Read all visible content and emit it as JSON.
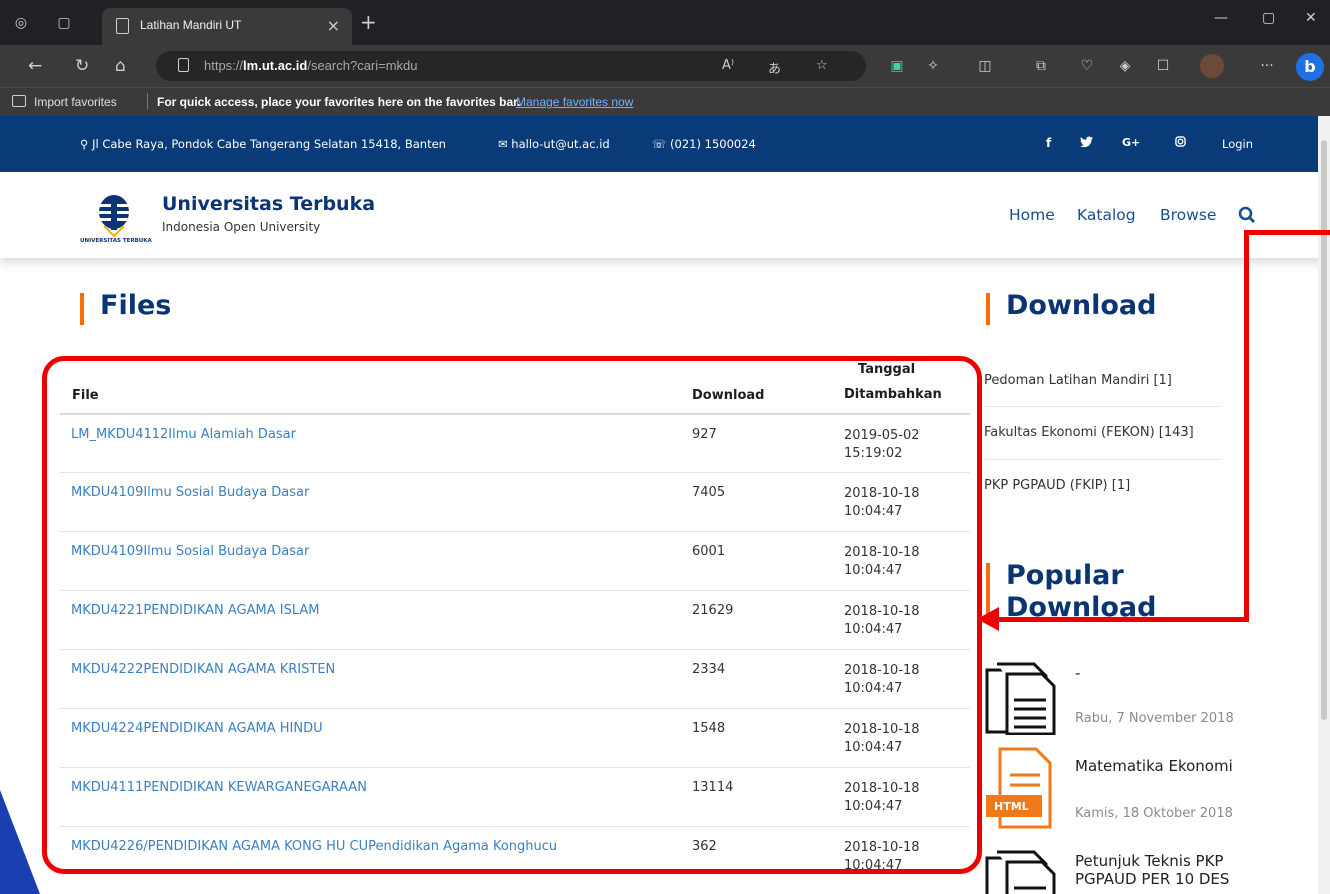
{
  "browser": {
    "tab_title": "Latihan Mandiri UT",
    "url_prefix": "https://",
    "url_domain": "lm.ut.ac.id",
    "url_path": "/search?cari=mkdu",
    "favbar_import": "Import favorites",
    "favbar_message": "For quick access, place your favorites here on the favorites bar.",
    "favbar_manage": "Manage favorites now"
  },
  "topbar": {
    "address": "Jl Cabe Raya, Pondok Cabe Tangerang Selatan 15418, Banten",
    "email": "hallo-ut@ut.ac.id",
    "phone": "(021) 1500024",
    "social": [
      "f",
      "G+"
    ],
    "login": "Login"
  },
  "header": {
    "brand": "Universitas Terbuka",
    "tagline": "Indonesia Open University",
    "logo_caption": "UNIVERSITAS TERBUKA",
    "menu": [
      "Home",
      "Katalog",
      "Browse"
    ]
  },
  "files": {
    "title": "Files",
    "columns": {
      "file": "File",
      "download": "Download",
      "date_line1": "Tanggal",
      "date_line2": "Ditambahkan"
    },
    "rows": [
      {
        "file": "LM_MKDU4112Ilmu Alamiah Dasar",
        "downloads": "927",
        "date": "2019-05-02",
        "time": "15:19:02"
      },
      {
        "file": "MKDU4109Ilmu Sosial Budaya Dasar",
        "downloads": "7405",
        "date": "2018-10-18",
        "time": "10:04:47"
      },
      {
        "file": "MKDU4109Ilmu Sosial Budaya Dasar",
        "downloads": "6001",
        "date": "2018-10-18",
        "time": "10:04:47"
      },
      {
        "file": "MKDU4221PENDIDIKAN AGAMA ISLAM",
        "downloads": "21629",
        "date": "2018-10-18",
        "time": "10:04:47"
      },
      {
        "file": "MKDU4222PENDIDIKAN AGAMA KRISTEN",
        "downloads": "2334",
        "date": "2018-10-18",
        "time": "10:04:47"
      },
      {
        "file": "MKDU4224PENDIDIKAN AGAMA HINDU",
        "downloads": "1548",
        "date": "2018-10-18",
        "time": "10:04:47"
      },
      {
        "file": "MKDU4111PENDIDIKAN KEWARGANEGARAAN",
        "downloads": "13114",
        "date": "2018-10-18",
        "time": "10:04:47"
      },
      {
        "file": "MKDU4226/PENDIDIKAN AGAMA KONG HU CUPendidikan Agama Konghucu",
        "downloads": "362",
        "date": "2018-10-18",
        "time": "10:04:47"
      }
    ]
  },
  "sidebar": {
    "download_title": "Download",
    "links": [
      "Pedoman Latihan Mandiri [1]",
      "Fakultas Ekonomi (FEKON) [143]",
      "PKP PGPAUD (FKIP) [1]"
    ],
    "popular_title_line1": "Popular",
    "popular_title_line2": "Download",
    "popular": [
      {
        "title": "-",
        "date": "Rabu, 7 November 2018",
        "icon": "document-icon"
      },
      {
        "title": "Matematika Ekonomi",
        "date": "Kamis, 18 Oktober 2018",
        "icon": "html-file-icon",
        "badge": "HTML"
      },
      {
        "title_line1": "Petunjuk Teknis PKP",
        "title_line2": "PGPAUD PER 10 DES",
        "icon": "document-icon"
      }
    ]
  },
  "colors": {
    "topbar_bg": "#093b79",
    "brand": "#0b3572",
    "accent": "#ff6b0a",
    "link": "#3a7fc1",
    "annotation": "#ee0000"
  }
}
